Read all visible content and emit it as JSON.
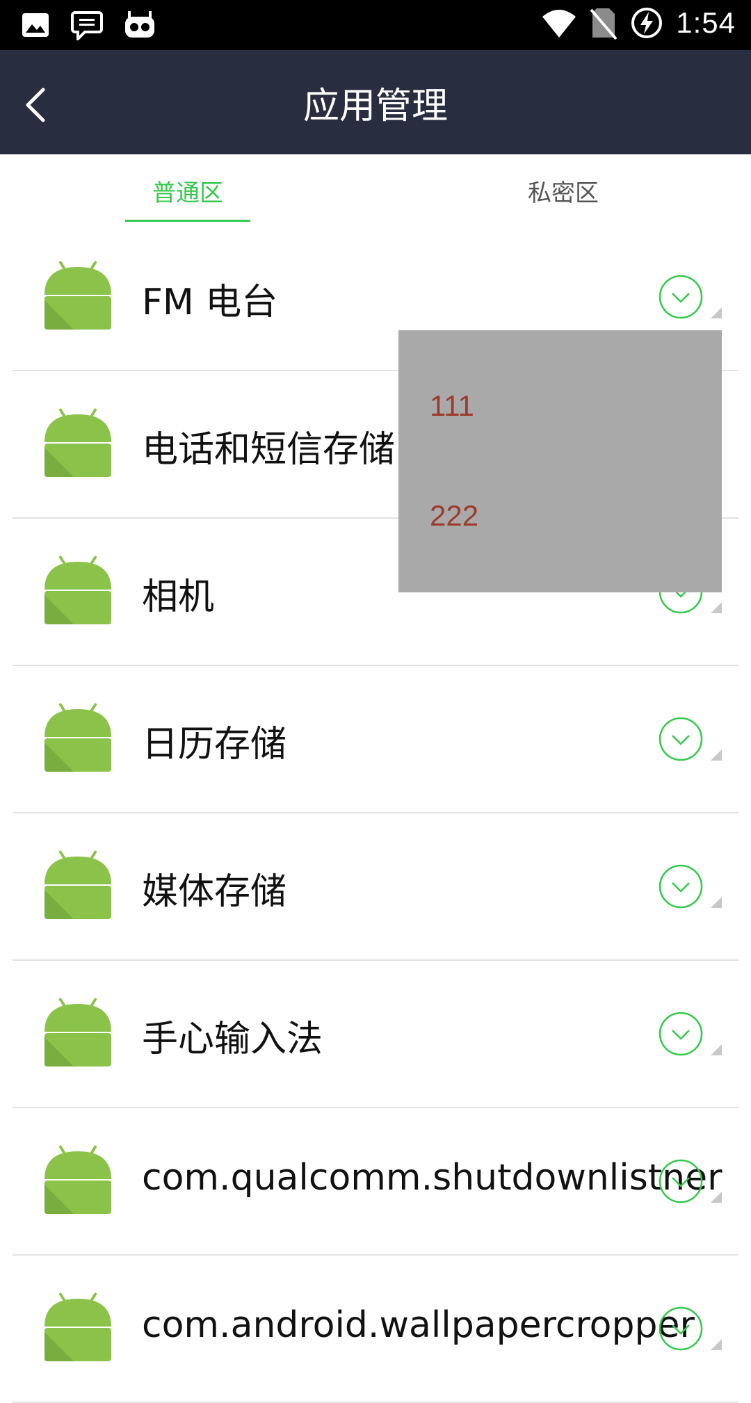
{
  "status_bar": {
    "time": "1:54",
    "left_icons": [
      "image-icon",
      "chat-icon",
      "robot-icon"
    ],
    "right_icons": [
      "wifi-icon",
      "no-sim-icon",
      "battery-charging-icon"
    ]
  },
  "header": {
    "title": "应用管理",
    "back_icon": "chevron-left-icon"
  },
  "tabs": [
    {
      "label": "普通区",
      "active": true
    },
    {
      "label": "私密区",
      "active": false
    }
  ],
  "apps": [
    {
      "name": "FM 电台"
    },
    {
      "name": "电话和短信存储"
    },
    {
      "name": "相机"
    },
    {
      "name": "日历存储"
    },
    {
      "name": "媒体存储"
    },
    {
      "name": "手心输入法"
    },
    {
      "name": "com.qualcomm.shutdownlistner"
    },
    {
      "name": "com.android.wallpapercropper"
    }
  ],
  "popup_menu": {
    "items": [
      "111",
      "222"
    ]
  },
  "colors": {
    "accent": "#35c84b",
    "header_bg": "#282d3f",
    "popup_bg": "#a9a9a9",
    "popup_text": "#9b3b2b",
    "android_green": "#8bc34a"
  }
}
